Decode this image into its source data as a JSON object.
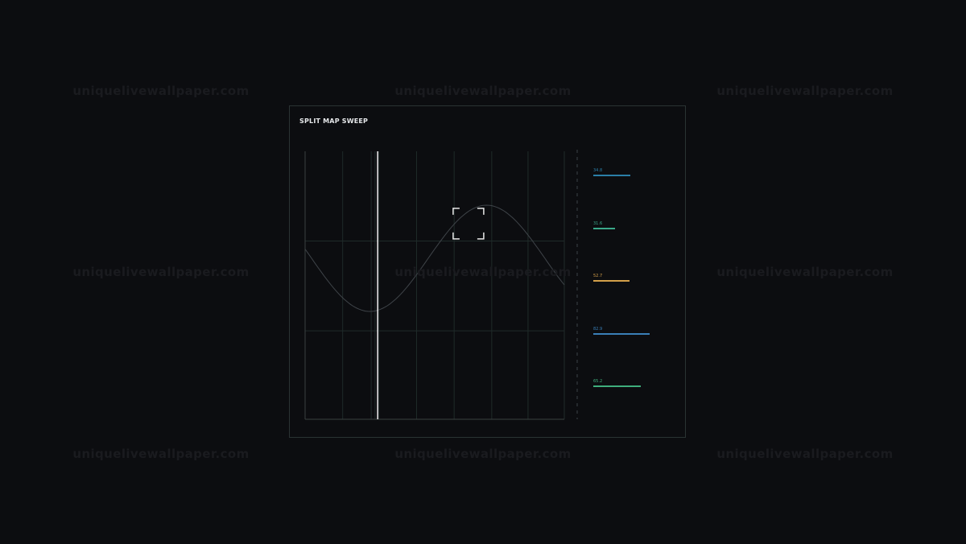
{
  "watermark": {
    "text": "uniquelivewallpaper.com"
  },
  "panel": {
    "title": "SPLIT MAP SWEEP",
    "subtitle": "",
    "footer": ""
  },
  "sweep": {
    "wave_color": "#3f4449",
    "cursor_color": "#f2f2f2",
    "grid_color": "#1f2b2a",
    "axis_color": "#3a4140",
    "divider_color": "#3d4247",
    "target_color": "#e8e8e8",
    "sweep_position": 0.28,
    "target_center": [
      0.63,
      0.27
    ]
  },
  "readouts": [
    {
      "label": "",
      "value": "34.8",
      "level": 0.43,
      "color": "#2b7fa8"
    },
    {
      "label": "",
      "value": "31.6",
      "level": 0.25,
      "color": "#3aa88a"
    },
    {
      "label": "",
      "value": "52.7",
      "level": 0.42,
      "color": "#d4a04a"
    },
    {
      "label": "",
      "value": "82.9",
      "level": 0.65,
      "color": "#3a7fb8"
    },
    {
      "label": "",
      "value": "65.2",
      "level": 0.55,
      "color": "#3fae7c"
    }
  ]
}
